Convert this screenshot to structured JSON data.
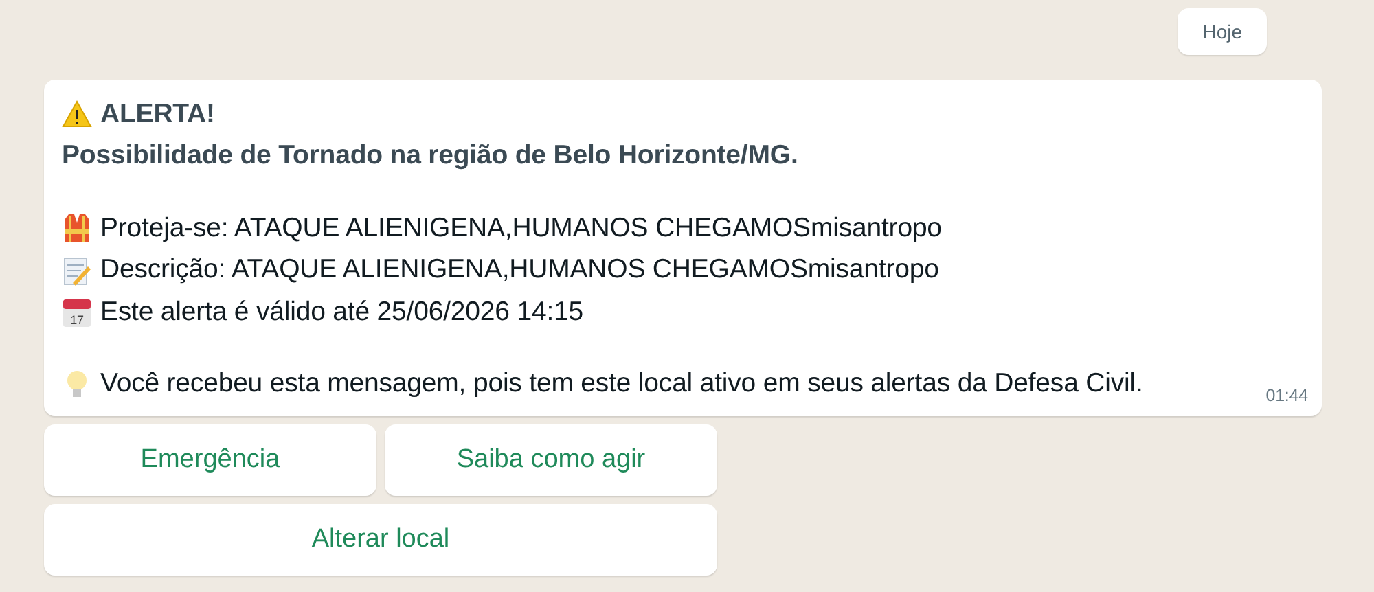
{
  "date_chip": "Hoje",
  "message": {
    "paragraphs": [
      [
        {
          "kind": "alert",
          "text": "ALERTA!"
        },
        {
          "kind": "headline",
          "text": "Possibilidade de Tornado na região de Belo Horizonte/MG."
        }
      ],
      [
        {
          "kind": "protect",
          "text": "Proteja-se: ATAQUE ALIENIGENA,HUMANOS CHEGAMOSmisantropo"
        },
        {
          "kind": "description",
          "text": "Descrição: ATAQUE ALIENIGENA,HUMANOS CHEGAMOSmisantropo"
        },
        {
          "kind": "validity",
          "text": "Este alerta é válido até 25/06/2026 14:15",
          "icon_text": "17"
        }
      ],
      [
        {
          "kind": "notice",
          "text": "Você recebeu esta mensagem, pois tem este local ativo em seus alertas da Defesa Civil."
        }
      ]
    ],
    "time": "01:44"
  },
  "buttons": [
    [
      "Emergência",
      "Saiba como agir"
    ],
    [
      "Alterar local"
    ]
  ]
}
